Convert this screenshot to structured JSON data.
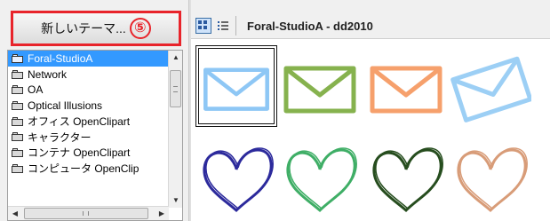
{
  "new_theme_button": {
    "label": "新しいテーマ...",
    "badge": "5"
  },
  "theme_list": {
    "items": [
      {
        "label": "Foral-StudioA",
        "selected": true
      },
      {
        "label": "Network",
        "selected": false
      },
      {
        "label": "OA",
        "selected": false
      },
      {
        "label": "Optical Illusions",
        "selected": false
      },
      {
        "label": "オフィス OpenClipart",
        "selected": false
      },
      {
        "label": "キャラクター",
        "selected": false
      },
      {
        "label": "コンテナ OpenClipart",
        "selected": false
      },
      {
        "label": "コンピュータ OpenClip",
        "selected": false
      }
    ]
  },
  "toolbar": {
    "title": "Foral-StudioA - dd2010"
  },
  "thumbnails": {
    "envelopes": [
      {
        "name": "envelope-light-blue",
        "color": "#8ec7f5"
      },
      {
        "name": "envelope-green",
        "color": "#86b24e"
      },
      {
        "name": "envelope-orange",
        "color": "#f6a06c"
      },
      {
        "name": "envelope-tilted-blue",
        "color": "#9ccff5"
      }
    ],
    "hearts": [
      {
        "name": "heart-dark-blue",
        "color": "#2c2a9c"
      },
      {
        "name": "heart-green",
        "color": "#3fae66"
      },
      {
        "name": "heart-dark-green",
        "color": "#264d1e"
      },
      {
        "name": "heart-peach",
        "color": "#d89c78"
      }
    ]
  }
}
